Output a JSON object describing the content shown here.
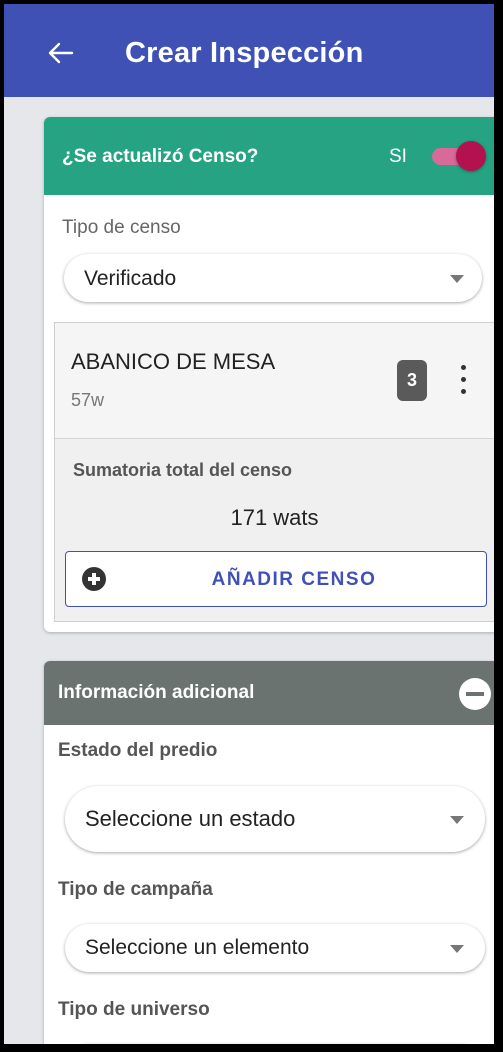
{
  "appbar": {
    "title": "Crear Inspección",
    "back_icon": "arrow-left-icon"
  },
  "census": {
    "question": "¿Se actualizó Censo?",
    "switch_text": "SI",
    "switch_on": true,
    "colors": {
      "header": "#26a383",
      "toggle": "#b3124e"
    },
    "type_label": "Tipo de censo",
    "type_value": "Verificado",
    "items": [
      {
        "name": "ABANICO DE MESA",
        "watts": "57w",
        "quantity": "3"
      }
    ],
    "sum_label": "Sumatoria total del censo",
    "sum_value": "171 wats",
    "add_button": "AÑADIR CENSO"
  },
  "additional": {
    "title": "Información adicional",
    "property_state_label": "Estado del predio",
    "property_state_value": "Seleccione un estado",
    "campaign_label": "Tipo de campaña",
    "campaign_value": "Seleccione un elemento",
    "universe_label": "Tipo de universo",
    "colors": {
      "header": "#6a736f"
    }
  }
}
